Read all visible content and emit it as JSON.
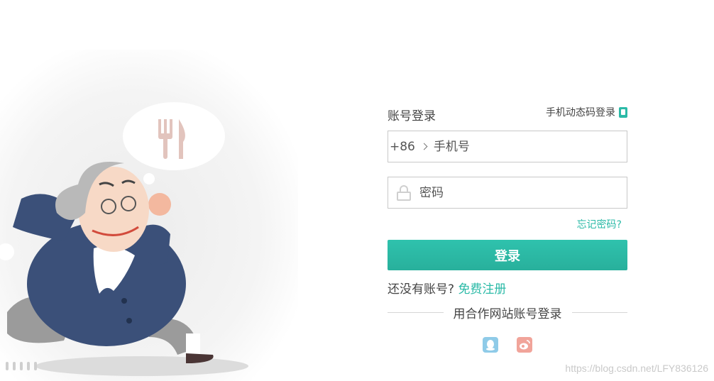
{
  "login": {
    "tab_account_label": "账号登录",
    "sms_login_label": "手机动态码登录",
    "country_code": "+86",
    "phone_placeholder": "手机号",
    "password_placeholder": "密码",
    "forgot_password_label": "忘记密码?",
    "login_button_label": "登录",
    "no_account_text": "还没有账号?",
    "register_label": "免费注册",
    "partner_login_label": "用合作网站账号登录"
  },
  "social": [
    {
      "name": "qq-icon",
      "color": "#8fcbe8"
    },
    {
      "name": "weibo-icon",
      "color": "#f1a49a"
    }
  ],
  "watermark": "https://blog.csdn.net/LFY836126",
  "colors": {
    "accent": "#2bbaa7",
    "button": "#2fc2ad"
  }
}
